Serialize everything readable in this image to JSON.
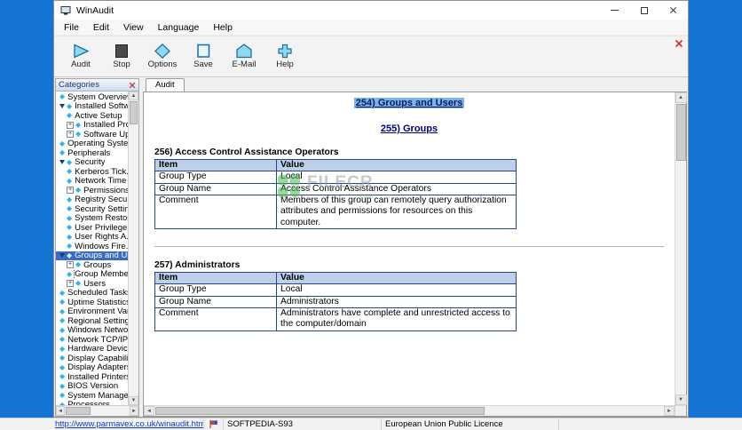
{
  "window": {
    "title": "WinAudit"
  },
  "menubar": {
    "items": [
      "File",
      "Edit",
      "View",
      "Language",
      "Help"
    ]
  },
  "toolbar": {
    "buttons": [
      {
        "label": "Audit",
        "icon": "audit-play-icon"
      },
      {
        "label": "Stop",
        "icon": "stop-square-icon"
      },
      {
        "label": "Options",
        "icon": "options-diamond-icon"
      },
      {
        "label": "Save",
        "icon": "save-square-icon"
      },
      {
        "label": "E-Mail",
        "icon": "email-envelope-icon"
      },
      {
        "label": "Help",
        "icon": "help-plus-icon"
      }
    ],
    "close_icon": "red-x-icon"
  },
  "sidebar": {
    "header": "Categories",
    "close_icon": "red-x-icon",
    "items": [
      {
        "label": "System Overview",
        "lvl": 0,
        "marker": "none"
      },
      {
        "label": "Installed Software",
        "lvl": 0,
        "marker": "expanded"
      },
      {
        "label": "Active Setup",
        "lvl": 1,
        "marker": "none"
      },
      {
        "label": "Installed Prog...",
        "lvl": 1,
        "marker": "plus"
      },
      {
        "label": "Software Upd...",
        "lvl": 1,
        "marker": "plus"
      },
      {
        "label": "Operating System",
        "lvl": 0,
        "marker": "none"
      },
      {
        "label": "Peripherals",
        "lvl": 0,
        "marker": "none"
      },
      {
        "label": "Security",
        "lvl": 0,
        "marker": "expanded"
      },
      {
        "label": "Kerberos Tick...",
        "lvl": 1,
        "marker": "none"
      },
      {
        "label": "Network Time",
        "lvl": 1,
        "marker": "none"
      },
      {
        "label": "Permissions",
        "lvl": 1,
        "marker": "plus"
      },
      {
        "label": "Registry Secu...",
        "lvl": 1,
        "marker": "none"
      },
      {
        "label": "Security Settin...",
        "lvl": 1,
        "marker": "none"
      },
      {
        "label": "System Restor...",
        "lvl": 1,
        "marker": "none"
      },
      {
        "label": "User Privilege...",
        "lvl": 1,
        "marker": "none"
      },
      {
        "label": "User Rights A...",
        "lvl": 1,
        "marker": "none"
      },
      {
        "label": "Windows Fire...",
        "lvl": 1,
        "marker": "none"
      },
      {
        "label": "Groups and Use...",
        "lvl": 0,
        "marker": "expanded",
        "selected": true
      },
      {
        "label": "Groups",
        "lvl": 1,
        "marker": "plus"
      },
      {
        "label": "Group Membe...",
        "lvl": 1,
        "marker": "none",
        "focused": true
      },
      {
        "label": "Users",
        "lvl": 1,
        "marker": "plus"
      },
      {
        "label": "Scheduled Tasks",
        "lvl": 0,
        "marker": "none"
      },
      {
        "label": "Uptime Statistics",
        "lvl": 0,
        "marker": "none"
      },
      {
        "label": "Environment Vari...",
        "lvl": 0,
        "marker": "none"
      },
      {
        "label": "Regional Settings",
        "lvl": 0,
        "marker": "none"
      },
      {
        "label": "Windows Networ...",
        "lvl": 0,
        "marker": "none"
      },
      {
        "label": "Network TCP/IP",
        "lvl": 0,
        "marker": "none"
      },
      {
        "label": "Hardware Device...",
        "lvl": 0,
        "marker": "none"
      },
      {
        "label": "Display Capabiliti...",
        "lvl": 0,
        "marker": "none"
      },
      {
        "label": "Display Adapters",
        "lvl": 0,
        "marker": "none"
      },
      {
        "label": "Installed Printers",
        "lvl": 0,
        "marker": "none"
      },
      {
        "label": "BIOS Version",
        "lvl": 0,
        "marker": "none"
      },
      {
        "label": "System Manage...",
        "lvl": 0,
        "marker": "none"
      },
      {
        "label": "Processors",
        "lvl": 0,
        "marker": "none"
      }
    ]
  },
  "tab": {
    "label": "Audit"
  },
  "report": {
    "title": {
      "text": "254) Groups and Users",
      "selected": true
    },
    "subtitle": "255) Groups",
    "sections": [
      {
        "heading": "256) Access Control Assistance Operators",
        "table": {
          "headers": [
            "Item",
            "Value"
          ],
          "rows": [
            [
              "Group Type",
              "Local"
            ],
            [
              "Group Name",
              "Access Control Assistance Operators"
            ],
            [
              "Comment",
              "Members of this group can remotely query authorization attributes and permissions for resources on this computer."
            ]
          ]
        }
      },
      {
        "heading": "257) Administrators",
        "table": {
          "headers": [
            "Item",
            "Value"
          ],
          "rows": [
            [
              "Group Type",
              "Local"
            ],
            [
              "Group Name",
              "Administrators"
            ],
            [
              "Comment",
              "Administrators have complete and unrestricted access to the computer/domain"
            ]
          ]
        }
      }
    ]
  },
  "watermark": {
    "name": "FILECR",
    "tld": ".com"
  },
  "statusbar": {
    "link": "http://www.parmavex.co.uk/winaudit.html",
    "flag_icon": "report-flag-icon",
    "softpedia_id": "SOFTPEDIA-S93",
    "licence": "European Union Public Licence"
  },
  "colors": {
    "desktop_bg": "#1474d4",
    "selection_blue": "#3a6bc4",
    "heading_navy": "#00007d",
    "table_header_bg": "#bcd0ea",
    "table_border": "#27477f",
    "icon_cyan": "#8fd8f0",
    "icon_outline": "#1b6fa0",
    "watermark_green": "#49a94f"
  }
}
